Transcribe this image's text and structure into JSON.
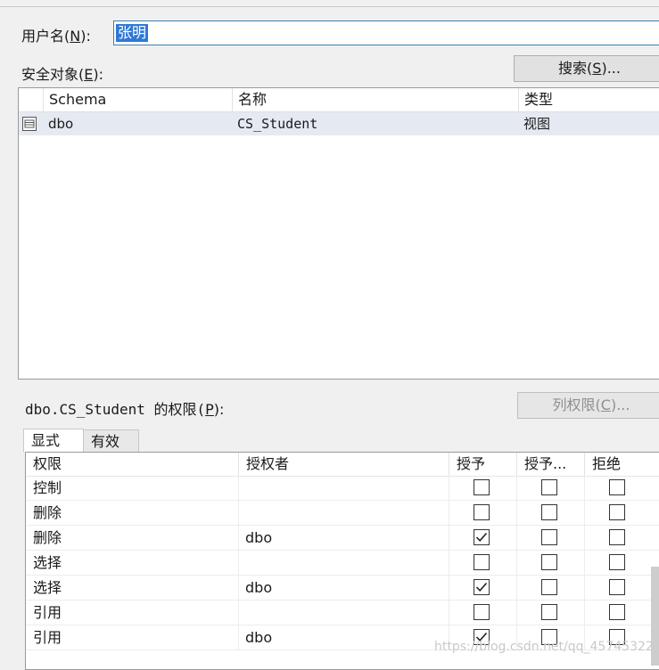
{
  "username": {
    "label": "用户名(",
    "hotkey": "N",
    "label_end": "):",
    "value": "张明"
  },
  "securables": {
    "label": "安全对象(",
    "hotkey": "E",
    "label_end": "):"
  },
  "search_button": {
    "label": "搜索(",
    "hotkey": "S",
    "label_end": ")..."
  },
  "securables_grid": {
    "headers": [
      "Schema",
      "名称",
      "类型"
    ],
    "rows": [
      {
        "schema": "dbo",
        "name": "CS_Student",
        "type": "视图"
      }
    ]
  },
  "permissions": {
    "label": "dbo.CS_Student 的权限(",
    "hotkey": "P",
    "label_end": "):",
    "column_perms_button": {
      "label": "列权限(",
      "hotkey": "C",
      "label_end": ")..."
    },
    "tabs": [
      "显式",
      "有效"
    ],
    "headers": [
      "权限",
      "授权者",
      "授予",
      "授予...",
      "拒绝"
    ],
    "rows": [
      {
        "permission": "控制",
        "grantor": "",
        "grant": false,
        "with_grant": false,
        "deny": false
      },
      {
        "permission": "删除",
        "grantor": "",
        "grant": false,
        "with_grant": false,
        "deny": false
      },
      {
        "permission": "删除",
        "grantor": "dbo",
        "grant": true,
        "with_grant": false,
        "deny": false
      },
      {
        "permission": "选择",
        "grantor": "",
        "grant": false,
        "with_grant": false,
        "deny": false
      },
      {
        "permission": "选择",
        "grantor": "dbo",
        "grant": true,
        "with_grant": false,
        "deny": false
      },
      {
        "permission": "引用",
        "grantor": "",
        "grant": false,
        "with_grant": false,
        "deny": false
      },
      {
        "permission": "引用",
        "grantor": "dbo",
        "grant": true,
        "with_grant": false,
        "deny": false
      }
    ]
  },
  "watermark": "https://blog.csdn.net/qq_45745322"
}
